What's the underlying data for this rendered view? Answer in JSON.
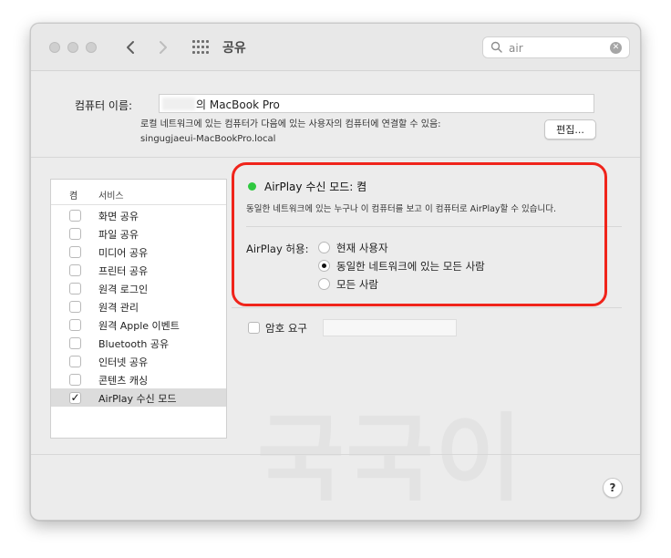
{
  "window": {
    "title": "공유",
    "search": {
      "value": "air"
    }
  },
  "computer_name": {
    "label": "컴퓨터 이름:",
    "value": "의 MacBook Pro",
    "note_line1": "로컬 네트워크에 있는 컴퓨터가 다음에 있는 사용자의 컴퓨터에 연결할 수 있음:",
    "note_line2": "singugjaeui-MacBookPro.local",
    "edit_label": "편집..."
  },
  "services": {
    "header_on": "켬",
    "header_service": "서비스",
    "items": [
      {
        "label": "화면 공유",
        "checked": false
      },
      {
        "label": "파일 공유",
        "checked": false
      },
      {
        "label": "미디어 공유",
        "checked": false
      },
      {
        "label": "프린터 공유",
        "checked": false
      },
      {
        "label": "원격 로그인",
        "checked": false
      },
      {
        "label": "원격 관리",
        "checked": false
      },
      {
        "label": "원격 Apple 이벤트",
        "checked": false
      },
      {
        "label": "Bluetooth 공유",
        "checked": false
      },
      {
        "label": "인터넷 공유",
        "checked": false
      },
      {
        "label": "콘텐츠 캐싱",
        "checked": false
      },
      {
        "label": "AirPlay 수신 모드",
        "checked": true,
        "selected": true
      }
    ]
  },
  "airplay": {
    "status": "AirPlay 수신 모드: 켬",
    "status_color": "#2fc840",
    "description": "동일한 네트워크에 있는 누구나 이 컴퓨터를 보고 이 컴퓨터로 AirPlay할 수 있습니다.",
    "allow_label": "AirPlay 허용:",
    "options": [
      {
        "label": "현재 사용자",
        "selected": false
      },
      {
        "label": "동일한 네트워크에 있는 모든 사람",
        "selected": true
      },
      {
        "label": "모든 사람",
        "selected": false
      }
    ],
    "password_label": "암호 요구"
  },
  "watermark": "국국이",
  "help_label": "?",
  "highlight_color": "#f0241b"
}
